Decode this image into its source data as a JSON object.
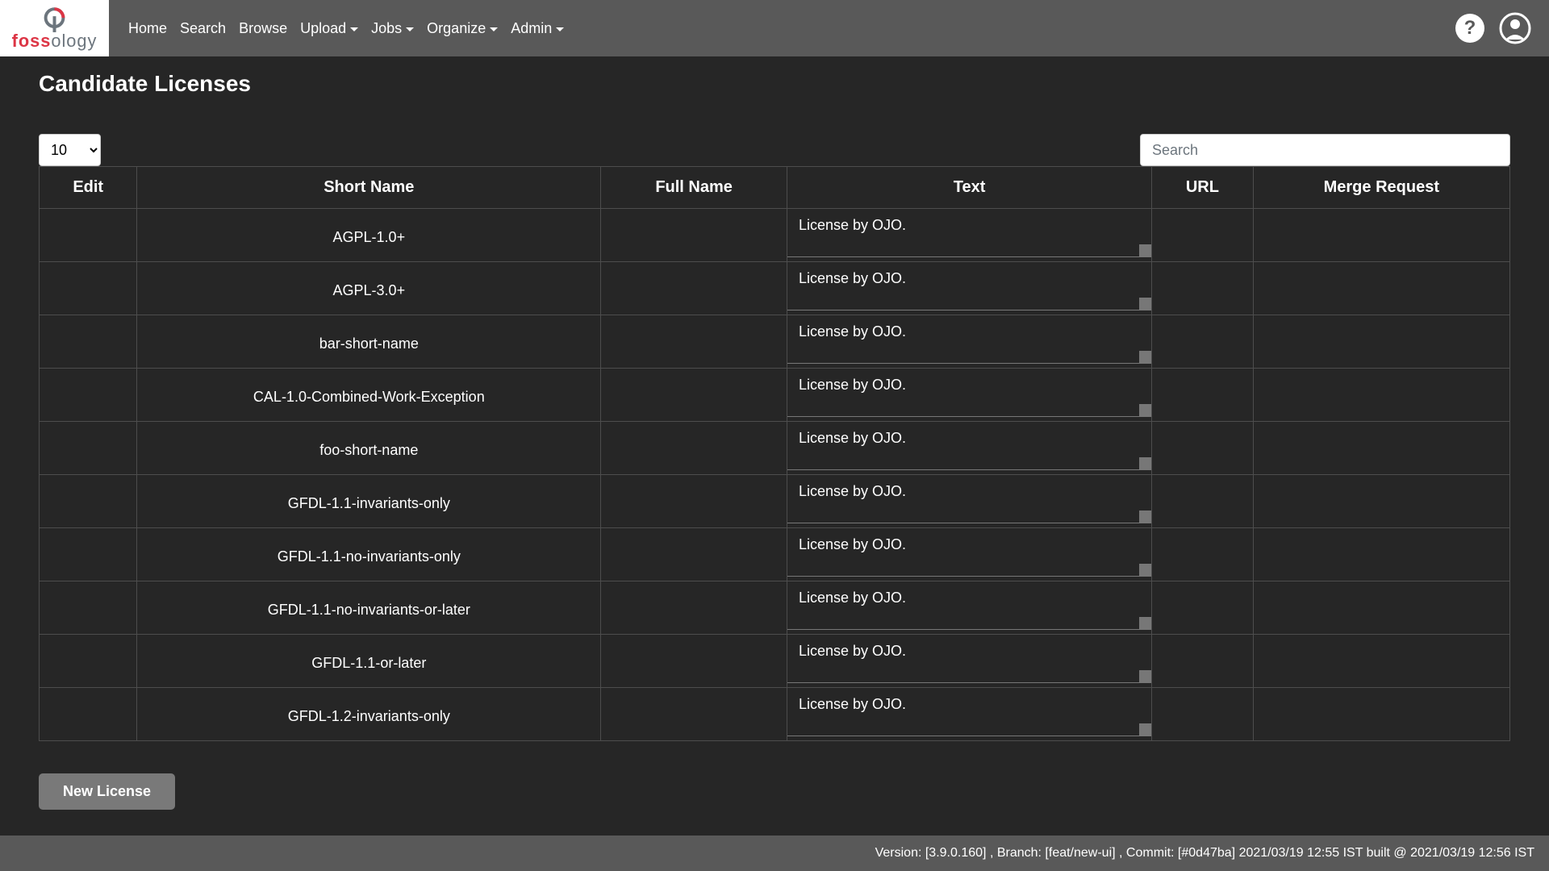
{
  "brand": {
    "foss": "foss",
    "ology": "ology"
  },
  "nav": {
    "items": [
      {
        "label": "Home",
        "dropdown": false
      },
      {
        "label": "Search",
        "dropdown": false
      },
      {
        "label": "Browse",
        "dropdown": false
      },
      {
        "label": "Upload",
        "dropdown": true
      },
      {
        "label": "Jobs",
        "dropdown": true
      },
      {
        "label": "Organize",
        "dropdown": true
      },
      {
        "label": "Admin",
        "dropdown": true
      }
    ]
  },
  "page": {
    "title": "Candidate Licenses",
    "page_size": "10",
    "search_placeholder": "Search"
  },
  "table": {
    "headers": {
      "edit": "Edit",
      "short": "Short Name",
      "full": "Full Name",
      "text": "Text",
      "url": "URL",
      "merge": "Merge Request"
    },
    "rows": [
      {
        "short": "AGPL-1.0+",
        "full": "",
        "text": "License by OJO.",
        "url": "",
        "merge": ""
      },
      {
        "short": "AGPL-3.0+",
        "full": "",
        "text": "License by OJO.",
        "url": "",
        "merge": ""
      },
      {
        "short": "bar-short-name",
        "full": "",
        "text": "License by OJO.",
        "url": "",
        "merge": ""
      },
      {
        "short": "CAL-1.0-Combined-Work-Exception",
        "full": "",
        "text": "License by OJO.",
        "url": "",
        "merge": ""
      },
      {
        "short": "foo-short-name",
        "full": "",
        "text": "License by OJO.",
        "url": "",
        "merge": ""
      },
      {
        "short": "GFDL-1.1-invariants-only",
        "full": "",
        "text": "License by OJO.",
        "url": "",
        "merge": ""
      },
      {
        "short": "GFDL-1.1-no-invariants-only",
        "full": "",
        "text": "License by OJO.",
        "url": "",
        "merge": ""
      },
      {
        "short": "GFDL-1.1-no-invariants-or-later",
        "full": "",
        "text": "License by OJO.",
        "url": "",
        "merge": ""
      },
      {
        "short": "GFDL-1.1-or-later",
        "full": "",
        "text": "License by OJO.",
        "url": "",
        "merge": ""
      },
      {
        "short": "GFDL-1.2-invariants-only",
        "full": "",
        "text": "License by OJO.",
        "url": "",
        "merge": ""
      }
    ]
  },
  "buttons": {
    "new_license": "New License"
  },
  "footer": {
    "version_label": "Version: ",
    "version": "[3.9.0.160]",
    "branch_label": ", Branch: ",
    "branch": "[feat/new-ui]",
    "commit_label": ", Commit: ",
    "commit": "[#0d47ba]",
    "build": " 2021/03/19 12:55 IST built @ 2021/03/19 12:56 IST"
  }
}
